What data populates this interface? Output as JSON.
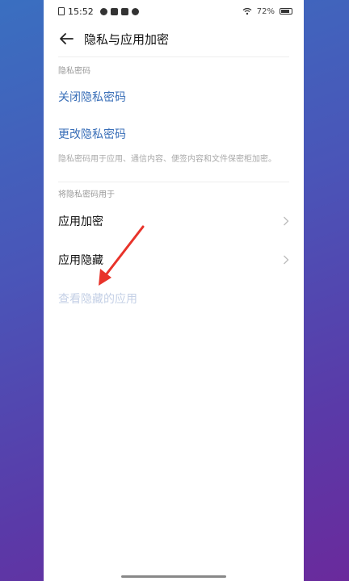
{
  "status_bar": {
    "time": "15:52",
    "battery": "72%"
  },
  "header": {
    "title": "隐私与应用加密"
  },
  "section_privacy_password": {
    "label": "隐私密码",
    "items": [
      {
        "label": "关闭隐私密码"
      },
      {
        "label": "更改隐私密码"
      }
    ],
    "note": "隐私密码用于应用、通信内容、便签内容和文件保密柜加密。"
  },
  "section_apply": {
    "label": "将隐私密码用于",
    "items": [
      {
        "label": "应用加密"
      },
      {
        "label": "应用隐藏"
      }
    ],
    "disabled_item": "查看隐藏的应用"
  },
  "colors": {
    "accent_blue": "#3a6fb8",
    "annotation_red": "#e8332a"
  }
}
